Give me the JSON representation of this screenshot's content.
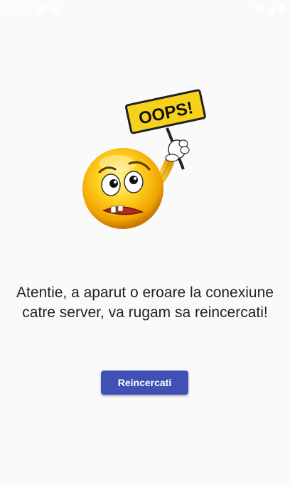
{
  "status_bar": {
    "time": "12:33",
    "icons": [
      "notification-icon",
      "notification-icon",
      "wifi-icon",
      "signal-icon",
      "battery-icon"
    ]
  },
  "illustration": {
    "sign_text": "OOPS!",
    "icon": "oops-emoji-illustration"
  },
  "error": {
    "message_line1": "Atentie, a aparut o eroare la conexiune",
    "message_line2": "catre server, va rugam sa reincercati!"
  },
  "actions": {
    "retry_label": "Reincercati"
  },
  "colors": {
    "background": "#fafafa",
    "button": "#3f51b5",
    "button_text": "#ffffff",
    "text": "#222222"
  }
}
